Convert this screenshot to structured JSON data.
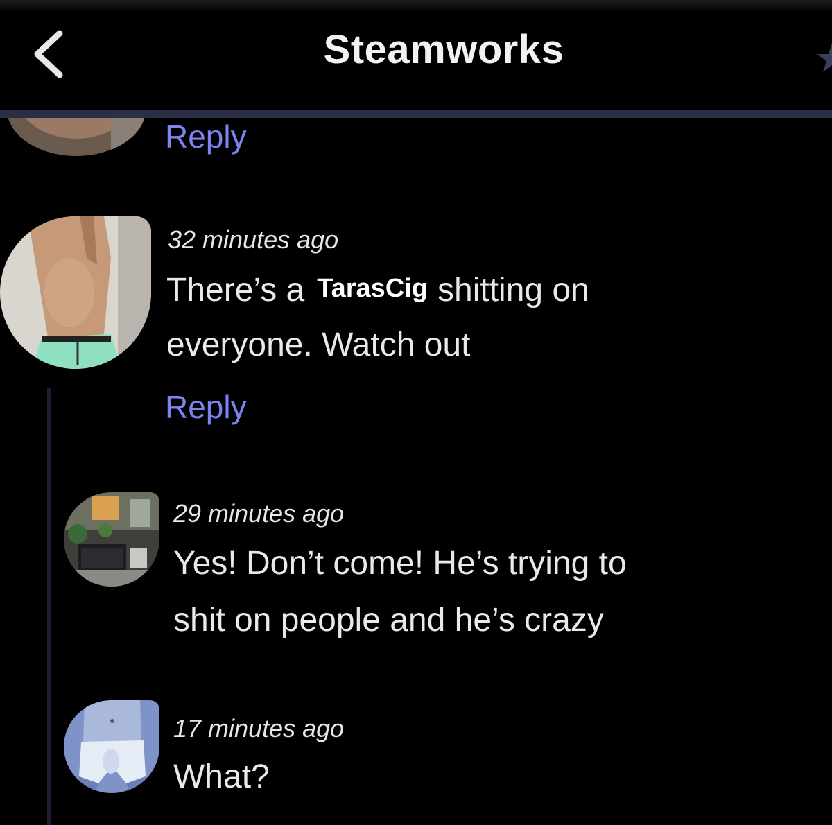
{
  "header": {
    "title": "Steamworks",
    "back_icon": "chevron-left-icon",
    "favorite_icon": "star-icon"
  },
  "comments": [
    {
      "avatar": "avatar-photo",
      "reply_label": "Reply"
    },
    {
      "avatar": "avatar-photo",
      "timestamp": "32 minutes ago",
      "text_before": "There’s a",
      "redaction_label": "TarasCig",
      "text_after": "shitting on",
      "text_line2": "everyone. Watch out",
      "reply_label": "Reply"
    },
    {
      "avatar": "avatar-photo",
      "timestamp": "29 minutes ago",
      "line1": "Yes! Don’t come! He’s trying to",
      "line2": "shit on people and he’s crazy"
    },
    {
      "avatar": "avatar-illustration",
      "timestamp": "17 minutes ago",
      "line1": "What?"
    }
  ],
  "colors": {
    "background": "#000000",
    "link": "#7d84f2",
    "text": "#e9e9e9",
    "divider": "#2a2f45",
    "thread_line": "#1c1e33"
  }
}
